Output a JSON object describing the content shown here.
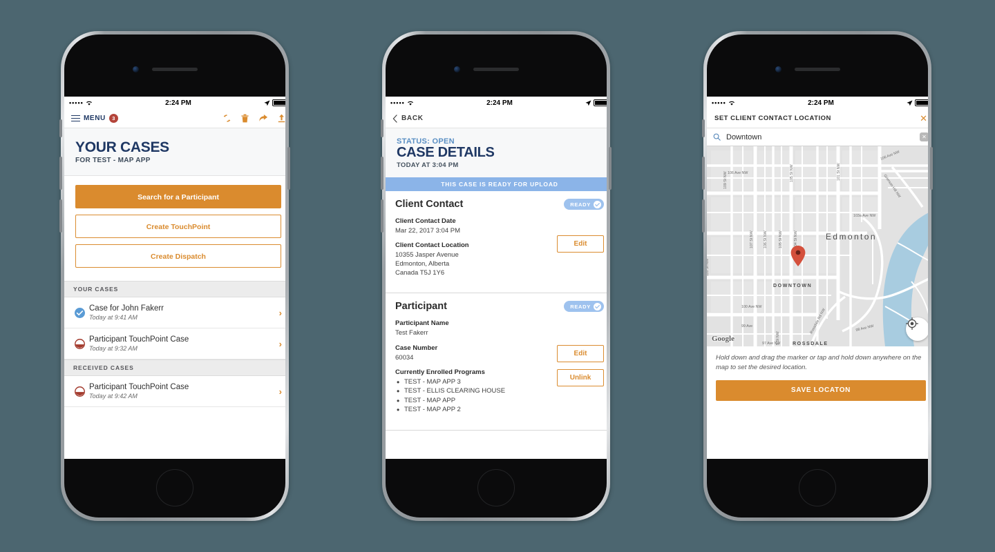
{
  "statusbar": {
    "signal": "•••••",
    "time": "2:24 PM"
  },
  "phone1": {
    "nav": {
      "menu_label": "MENU",
      "badge": "3",
      "icons": [
        "refresh-icon",
        "trash-icon",
        "share-icon",
        "upload-icon"
      ]
    },
    "hero": {
      "title": "YOUR CASES",
      "subtitle": "FOR TEST - MAP APP"
    },
    "buttons": [
      {
        "label": "Search for a Participant",
        "style": "filled"
      },
      {
        "label": "Create TouchPoint",
        "style": "outline"
      },
      {
        "label": "Create Dispatch",
        "style": "outline"
      }
    ],
    "sections": [
      {
        "header": "YOUR CASES",
        "rows": [
          {
            "title": "Case for John Fakerr",
            "sub": "Today at 9:41 AM",
            "status": "complete"
          },
          {
            "title": "Participant TouchPoint Case",
            "sub": "Today at 9:32 AM",
            "status": "partial"
          }
        ]
      },
      {
        "header": "RECEIVED CASES",
        "rows": [
          {
            "title": "Participant TouchPoint Case",
            "sub": "Today at 9:42 AM",
            "status": "partial"
          }
        ]
      }
    ]
  },
  "phone2": {
    "nav": {
      "back_label": "BACK"
    },
    "hero": {
      "status": "STATUS: OPEN",
      "title": "CASE DETAILS",
      "date": "TODAY AT 3:04 PM"
    },
    "banner": "THIS CASE IS READY FOR UPLOAD",
    "section1": {
      "title": "Client Contact",
      "badge": "READY",
      "date_label": "Client Contact Date",
      "date_value": "Mar 22, 2017 3:04 PM",
      "location_label": "Client Contact Location",
      "location_value": "10355 Jasper Avenue\nEdmonton, Alberta\nCanada T5J 1Y6",
      "edit_label": "Edit"
    },
    "section2": {
      "title": "Participant",
      "badge": "READY",
      "name_label": "Participant Name",
      "name_value": "Test Fakerr",
      "case_label": "Case Number",
      "case_value": "60034",
      "programs_label": "Currently Enrolled Programs",
      "programs": [
        "TEST - MAP APP 3",
        "TEST - ELLIS CLEARING HOUSE",
        "TEST - MAP APP",
        "TEST - MAP APP 2"
      ],
      "edit_label": "Edit",
      "unlink_label": "Unlink"
    }
  },
  "phone3": {
    "nav": {
      "title": "SET CLIENT CONTACT LOCATION",
      "close": "✕"
    },
    "search": {
      "value": "Downtown",
      "clear": "✕"
    },
    "map": {
      "attribution": "Google",
      "city_label": "Edmonton",
      "neighborhoods": [
        "DOWNTOWN",
        "ROSSDALE"
      ],
      "streets": [
        "106 Ave NW",
        "105 St NW",
        "101 St NW",
        "109 St NW",
        "103a Ave NW",
        "107 St NW",
        "106 St NW",
        "105 St NW",
        "104 St NW",
        "106 Ave NW",
        "100 Ave NW",
        "99 Ave",
        "97 Ave NW",
        "98 Ave NW",
        "Rossdale Rd NW",
        "Grierson Hill NW",
        "110 St NW",
        "5 St NW"
      ]
    },
    "hint": "Hold down and drag the marker or tap and hold down anywhere on the map to set the desired location.",
    "save_label": "SAVE LOCATON"
  },
  "colors": {
    "background": "#4c6670",
    "accent_orange": "#da8b2e",
    "navy": "#1f3864",
    "blue_banner": "#8bb4e8",
    "badge_red": "#b4443a",
    "marker_red": "#d4503c"
  }
}
